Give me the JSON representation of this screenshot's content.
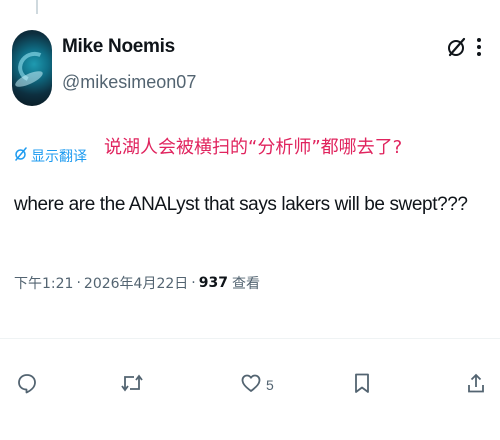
{
  "author": {
    "display_name": "Mike Noemis",
    "handle": "@mikesimeon07"
  },
  "translation": {
    "show_translation_label": "显示翻译",
    "translated_text": "说湖人会被横扫的“分析师”都哪去了?"
  },
  "tweet": {
    "text": "where are the ANALyst that says lakers will be swept???"
  },
  "meta": {
    "timestamp": "下午1:21",
    "separator": "·",
    "date": "2026年4月22日",
    "views_count": "937",
    "views_label": "查看"
  },
  "actions": {
    "reply": {
      "icon": "reply-icon",
      "count": ""
    },
    "retweet": {
      "icon": "retweet-icon",
      "count": ""
    },
    "like": {
      "icon": "heart-icon",
      "count": "5"
    },
    "bookmark": {
      "icon": "bookmark-icon",
      "count": ""
    },
    "share": {
      "icon": "share-icon",
      "count": ""
    }
  },
  "colors": {
    "text_primary": "#0f1419",
    "text_secondary": "#536471",
    "link_blue": "#1d9bf0",
    "translation_red": "#e0245e"
  }
}
